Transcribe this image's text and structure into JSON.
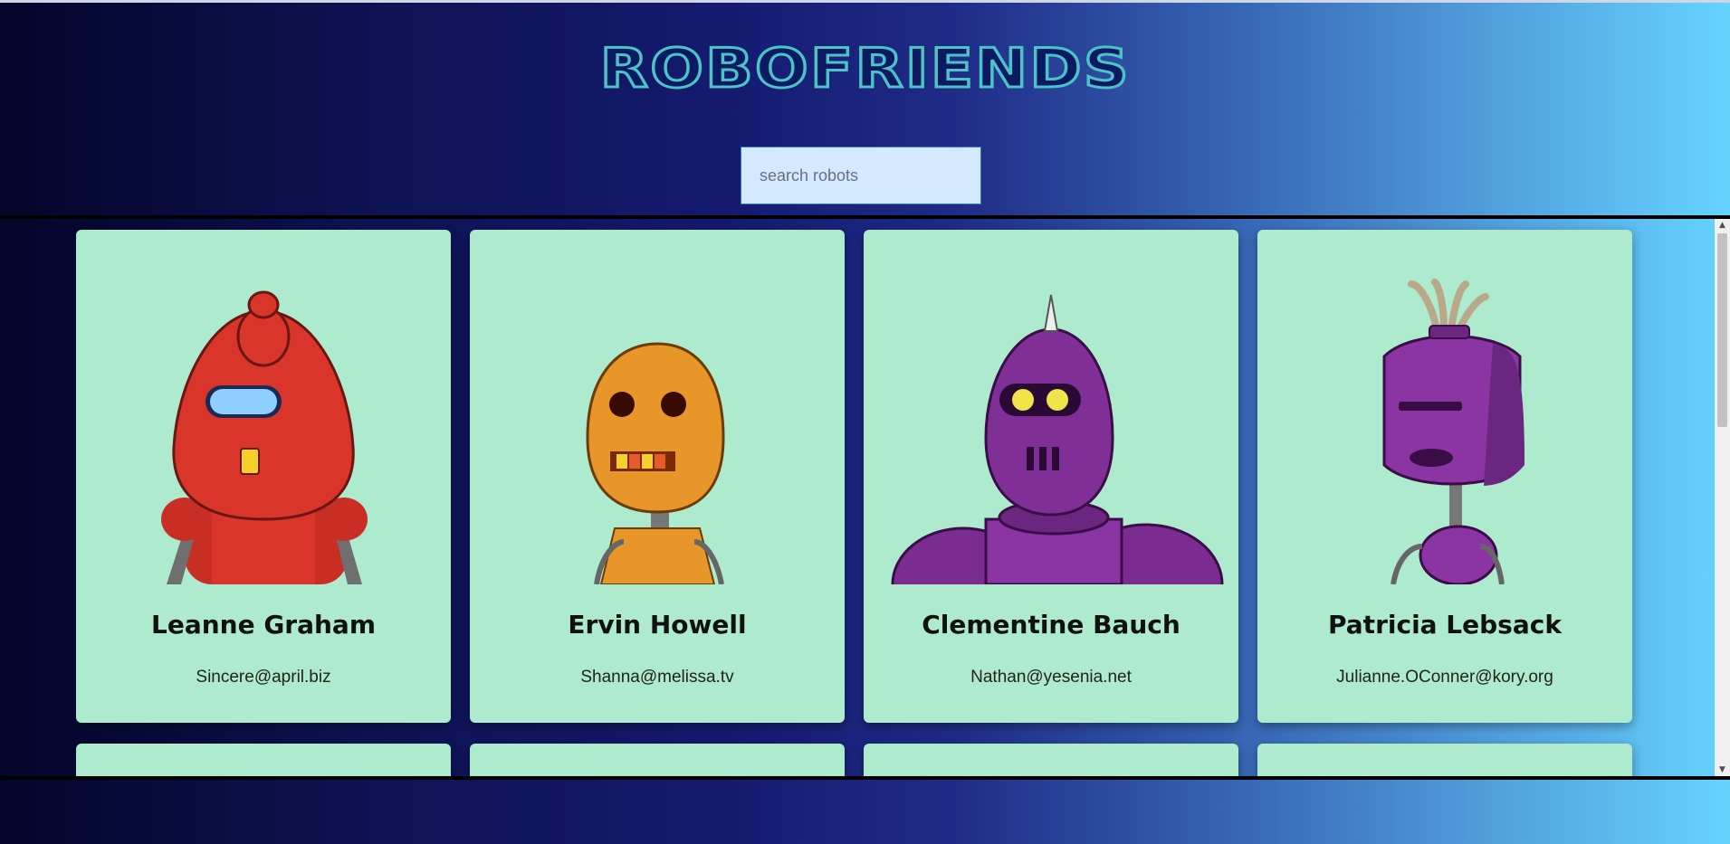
{
  "header": {
    "title": "ROBOFRIENDS"
  },
  "search": {
    "placeholder": "search robots",
    "value": ""
  },
  "robots": [
    {
      "name": "Leanne Graham",
      "email": "Sincere@april.biz",
      "color": "#d9352a"
    },
    {
      "name": "Ervin Howell",
      "email": "Shanna@melissa.tv",
      "color": "#e8952a"
    },
    {
      "name": "Clementine Bauch",
      "email": "Nathan@yesenia.net",
      "color": "#7f2f96"
    },
    {
      "name": "Patricia Lebsack",
      "email": "Julianne.OConner@kory.org",
      "color": "#8a35a3"
    }
  ],
  "colors": {
    "card_bg": "#aeeace",
    "logo_fill": "#0b1a63",
    "logo_stroke": "#4cc4c7",
    "search_bg": "#d4e8ff"
  }
}
